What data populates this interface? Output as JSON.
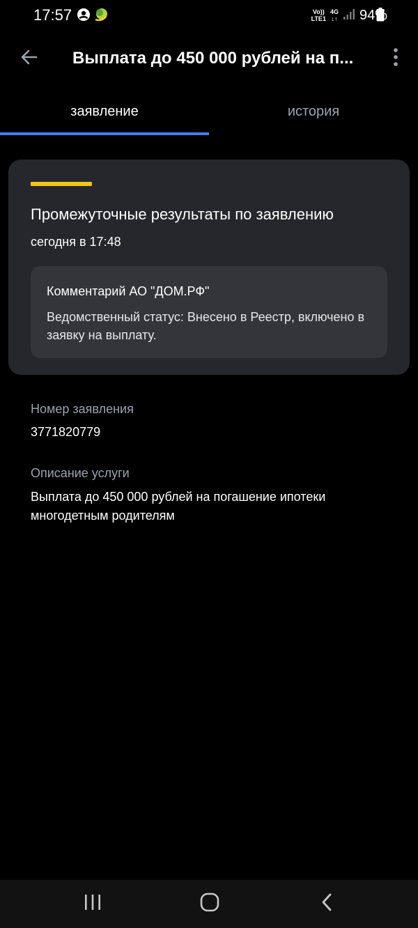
{
  "status_bar": {
    "time": "17:57",
    "network_top": "Vo))",
    "network_bottom": "LTE1",
    "network_type": "4G",
    "battery": "94%",
    "icons": [
      "user-circle-icon",
      "app-notification-icon",
      "signal-icon",
      "battery-icon"
    ]
  },
  "app_bar": {
    "title": "Выплата до 450 000 рублей на п...",
    "icons": [
      "arrow-left-icon",
      "more-vertical-icon"
    ]
  },
  "tabs": [
    {
      "label": "заявление",
      "active": true
    },
    {
      "label": "история",
      "active": false
    }
  ],
  "result_card": {
    "title": "Промежуточные результаты по заявлению",
    "time": "сегодня в 17:48",
    "comment_title": "Комментарий АО \"ДОМ.РФ\"",
    "comment_text": "Ведомственный статус: Внесено в Реестр, включено в заявку на выплату."
  },
  "fields": {
    "application_number_label": "Номер заявления",
    "application_number_value": "3771820779",
    "service_description_label": "Описание услуги",
    "service_description_value": "Выплата до 450 000 рублей на погашение ипотеки многодетным родителям"
  },
  "nav_bar": {
    "icons": [
      "recent-apps-icon",
      "home-icon",
      "back-icon"
    ]
  },
  "colors": {
    "background": "#000000",
    "card": "#26272c",
    "comment_box": "#34353a",
    "accent_yellow": "#f2c511",
    "tab_indicator": "#3d7ef5",
    "muted_text": "#9aa3b2"
  }
}
